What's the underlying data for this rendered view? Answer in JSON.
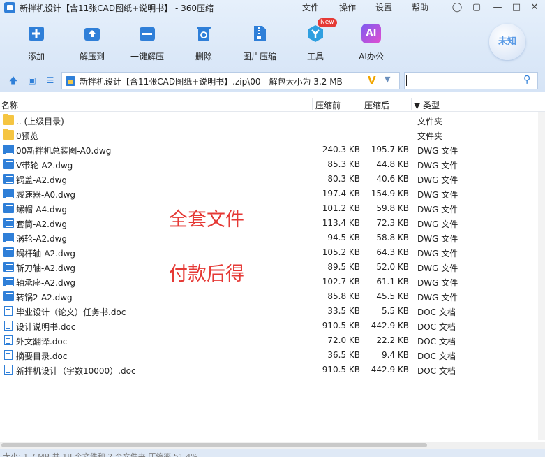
{
  "window": {
    "title": "新拌机设计【含11张CAD图纸+说明书】 - 360压缩",
    "menu": [
      "文件",
      "操作",
      "设置",
      "帮助"
    ]
  },
  "toolbar": {
    "items": [
      {
        "label": "添加",
        "icon": "add-icon"
      },
      {
        "label": "解压到",
        "icon": "extract-to-icon"
      },
      {
        "label": "一键解压",
        "icon": "one-click-extract-icon"
      },
      {
        "label": "删除",
        "icon": "delete-icon"
      },
      {
        "label": "图片压缩",
        "icon": "image-compress-icon"
      },
      {
        "label": "工具",
        "icon": "tools-icon"
      },
      {
        "label": "AI办公",
        "icon": "ai-office-icon"
      }
    ],
    "new_badge": "New",
    "ai_icon_text": "AI",
    "account_label": "未知"
  },
  "address": {
    "path": "新拌机设计【含11张CAD图纸+说明书】.zip\\00 - 解包大小为 3.2 MB",
    "v_mark": "V",
    "search_value": ""
  },
  "columns": {
    "name": "名称",
    "packed": "压缩前",
    "compressed": "压缩后",
    "type": "▼ 类型"
  },
  "files": [
    {
      "name": ".. (上级目录)",
      "packed": "",
      "compressed": "",
      "type": "文件夹",
      "kind": "folder"
    },
    {
      "name": "0预览",
      "packed": "",
      "compressed": "",
      "type": "文件夹",
      "kind": "folder"
    },
    {
      "name": "00新拌机总装图-A0.dwg",
      "packed": "240.3 KB",
      "compressed": "195.7 KB",
      "type": "DWG 文件",
      "kind": "dwg"
    },
    {
      "name": "V带轮-A2.dwg",
      "packed": "85.3 KB",
      "compressed": "44.8 KB",
      "type": "DWG 文件",
      "kind": "dwg"
    },
    {
      "name": "锅盖-A2.dwg",
      "packed": "80.3 KB",
      "compressed": "40.6 KB",
      "type": "DWG 文件",
      "kind": "dwg"
    },
    {
      "name": "减速器-A0.dwg",
      "packed": "197.4 KB",
      "compressed": "154.9 KB",
      "type": "DWG 文件",
      "kind": "dwg"
    },
    {
      "name": "螺帽-A4.dwg",
      "packed": "101.2 KB",
      "compressed": "59.8 KB",
      "type": "DWG 文件",
      "kind": "dwg"
    },
    {
      "name": "套筒-A2.dwg",
      "packed": "113.4 KB",
      "compressed": "72.3 KB",
      "type": "DWG 文件",
      "kind": "dwg"
    },
    {
      "name": "涡轮-A2.dwg",
      "packed": "94.5 KB",
      "compressed": "58.8 KB",
      "type": "DWG 文件",
      "kind": "dwg"
    },
    {
      "name": "蜗杆轴-A2.dwg",
      "packed": "105.2 KB",
      "compressed": "64.3 KB",
      "type": "DWG 文件",
      "kind": "dwg"
    },
    {
      "name": "斩刀轴-A2.dwg",
      "packed": "89.5 KB",
      "compressed": "52.0 KB",
      "type": "DWG 文件",
      "kind": "dwg"
    },
    {
      "name": "轴承座-A2.dwg",
      "packed": "102.7 KB",
      "compressed": "61.1 KB",
      "type": "DWG 文件",
      "kind": "dwg"
    },
    {
      "name": "转锅2-A2.dwg",
      "packed": "85.8 KB",
      "compressed": "45.5 KB",
      "type": "DWG 文件",
      "kind": "dwg"
    },
    {
      "name": "毕业设计（论文）任务书.doc",
      "packed": "33.5 KB",
      "compressed": "5.5 KB",
      "type": "DOC 文档",
      "kind": "doc"
    },
    {
      "name": "设计说明书.doc",
      "packed": "910.5 KB",
      "compressed": "442.9 KB",
      "type": "DOC 文档",
      "kind": "doc"
    },
    {
      "name": "外文翻译.doc",
      "packed": "72.0 KB",
      "compressed": "22.2 KB",
      "type": "DOC 文档",
      "kind": "doc"
    },
    {
      "name": "摘要目录.doc",
      "packed": "36.5 KB",
      "compressed": "9.4 KB",
      "type": "DOC 文档",
      "kind": "doc"
    },
    {
      "name": "新拌机设计（字数10000）.doc",
      "packed": "910.5 KB",
      "compressed": "442.9 KB",
      "type": "DOC 文档",
      "kind": "doc"
    }
  ],
  "overlay": {
    "line1": "全套文件",
    "line2": "付款后得"
  },
  "status": {
    "text": "大小: 1.7 MB 共 18 个文件和 2 个文件夹 压缩率 51.4%"
  },
  "colors": {
    "accent": "#2f7fd8",
    "overlay_text": "#e53935",
    "folder": "#f5c542"
  }
}
